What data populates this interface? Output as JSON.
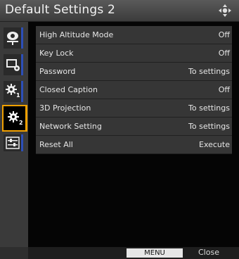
{
  "window": {
    "title": "Default Settings 2"
  },
  "sidebar": {
    "tabs": [
      {
        "icon": "projector-icon",
        "sub": ""
      },
      {
        "icon": "display-settings-icon",
        "sub": ""
      },
      {
        "icon": "settings-gear-icon",
        "sub": "1"
      },
      {
        "icon": "settings-gear-icon",
        "sub": "2",
        "active": true
      },
      {
        "icon": "adjustment-sliders-icon",
        "sub": ""
      }
    ]
  },
  "settings": {
    "rows": [
      {
        "label": "High Altitude Mode",
        "value": "Off"
      },
      {
        "label": "Key Lock",
        "value": "Off"
      },
      {
        "label": "Password",
        "value": "To settings"
      },
      {
        "label": "Closed Caption",
        "value": "Off"
      },
      {
        "label": "3D Projection",
        "value": "To settings"
      },
      {
        "label": "Network Setting",
        "value": "To settings"
      },
      {
        "label": "Reset All",
        "value": "Execute"
      }
    ]
  },
  "footer": {
    "menu_key": "MENU",
    "close_label": "Close"
  },
  "colors": {
    "accent_active": "#f0a000",
    "tab_indicator": "#2c4fb8",
    "row_background": "#363636"
  }
}
